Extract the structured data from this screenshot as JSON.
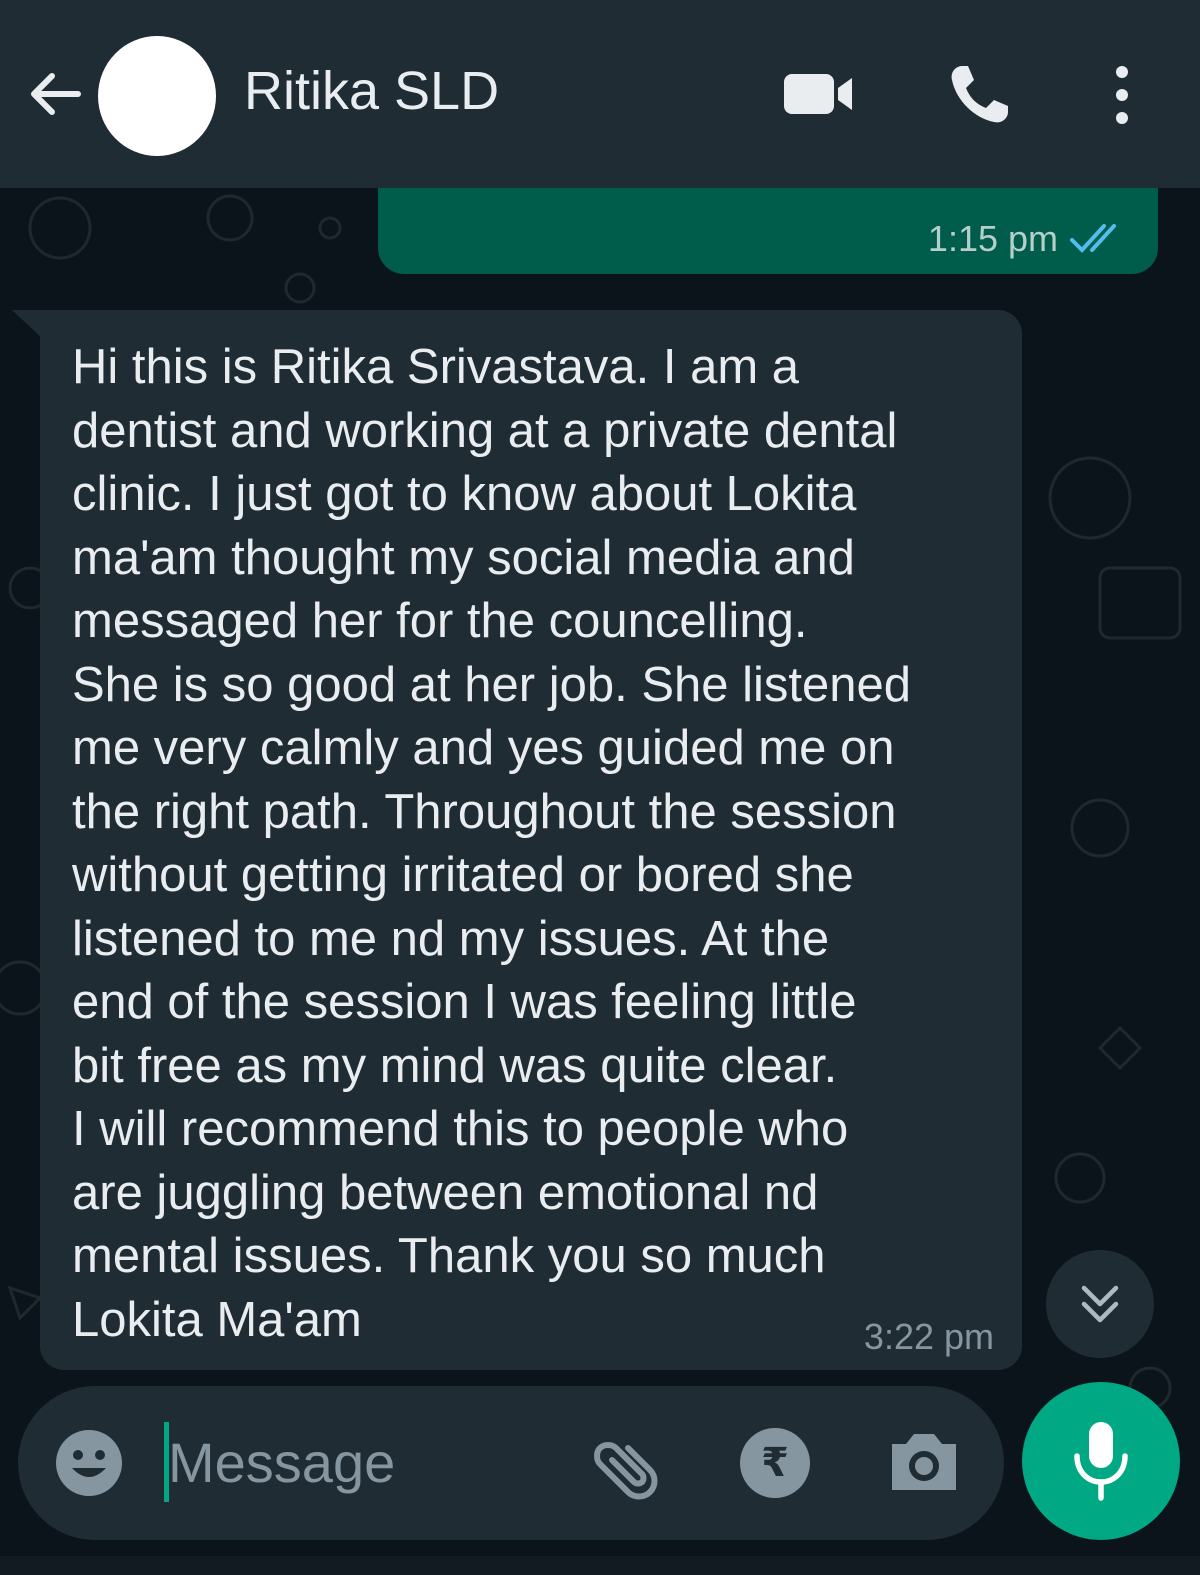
{
  "header": {
    "contact_name": "Ritika SLD"
  },
  "messages": [
    {
      "direction": "outgoing",
      "time": "1:15 pm",
      "status": "read"
    },
    {
      "direction": "incoming",
      "text": "Hi this is Ritika Srivastava. I am a\ndentist and working at a private dental\nclinic. I just got to know about Lokita\nma'am thought my social media and\nmessaged her for the councelling.\nShe is so good at her job. She listened\nme very calmly and yes guided me on\nthe right path. Throughout the session\nwithout getting irritated or bored she\nlistened to me nd my issues. At the\nend of the session I was feeling little\nbit free as my mind was quite clear.\nI will recommend this to people who\nare juggling between emotional nd\nmental issues. Thank you so much\nLokita Ma'am",
      "time": "3:22 pm"
    }
  ],
  "composer": {
    "placeholder": "Message",
    "value": "",
    "rupee_symbol": "₹"
  },
  "icons": {
    "back": "arrow-left-icon",
    "video": "video-camera-icon",
    "call": "phone-icon",
    "menu": "more-vertical-icon",
    "read_status": "double-check-icon",
    "scroll": "double-chevron-down-icon",
    "emoji": "smiley-icon",
    "attach": "paperclip-icon",
    "payment": "rupee-icon",
    "camera": "camera-icon",
    "mic": "microphone-icon"
  },
  "colors": {
    "header_bg": "#1f2c34",
    "chat_bg": "#0b141a",
    "outgoing_bubble": "#005c4b",
    "incoming_bubble": "#202c33",
    "accent": "#00a884",
    "read_tick": "#53bdeb"
  }
}
